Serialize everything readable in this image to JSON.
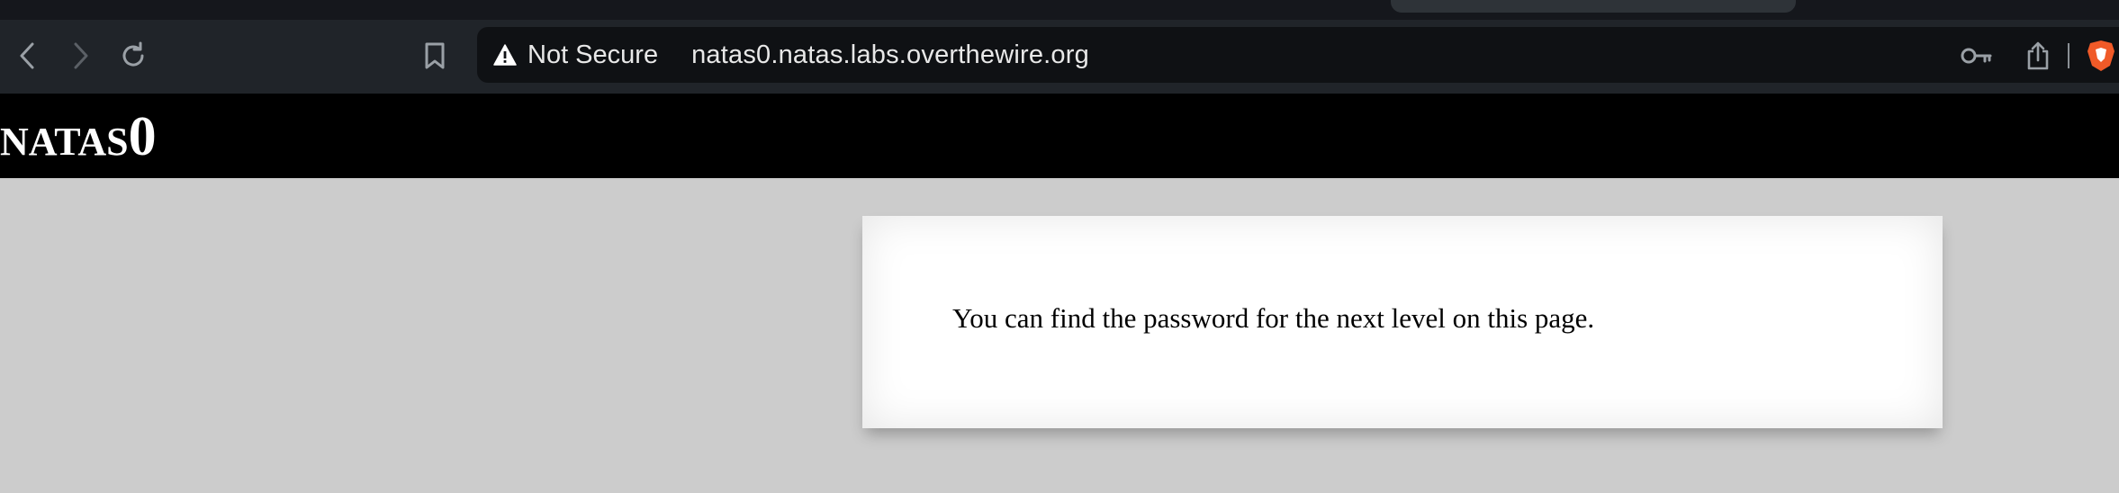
{
  "browser": {
    "security_label": "Not Secure",
    "url": "natas0.natas.labs.overthewire.org",
    "icons": [
      "back-icon",
      "forward-icon",
      "reload-icon",
      "bookmark-icon",
      "warning-icon",
      "key-icon",
      "share-icon",
      "brave-shield-icon"
    ],
    "colors": {
      "chrome_bg": "#202429",
      "url_bar_bg": "#0f1114",
      "text": "#e8e8e8",
      "brave_orange": "#f05a28"
    }
  },
  "site": {
    "title_prefix": "NATAS",
    "title_level": "0",
    "header_bg": "#000000",
    "page_bg": "#cccccc"
  },
  "content": {
    "message": "You can find the password for the next level on this page."
  }
}
